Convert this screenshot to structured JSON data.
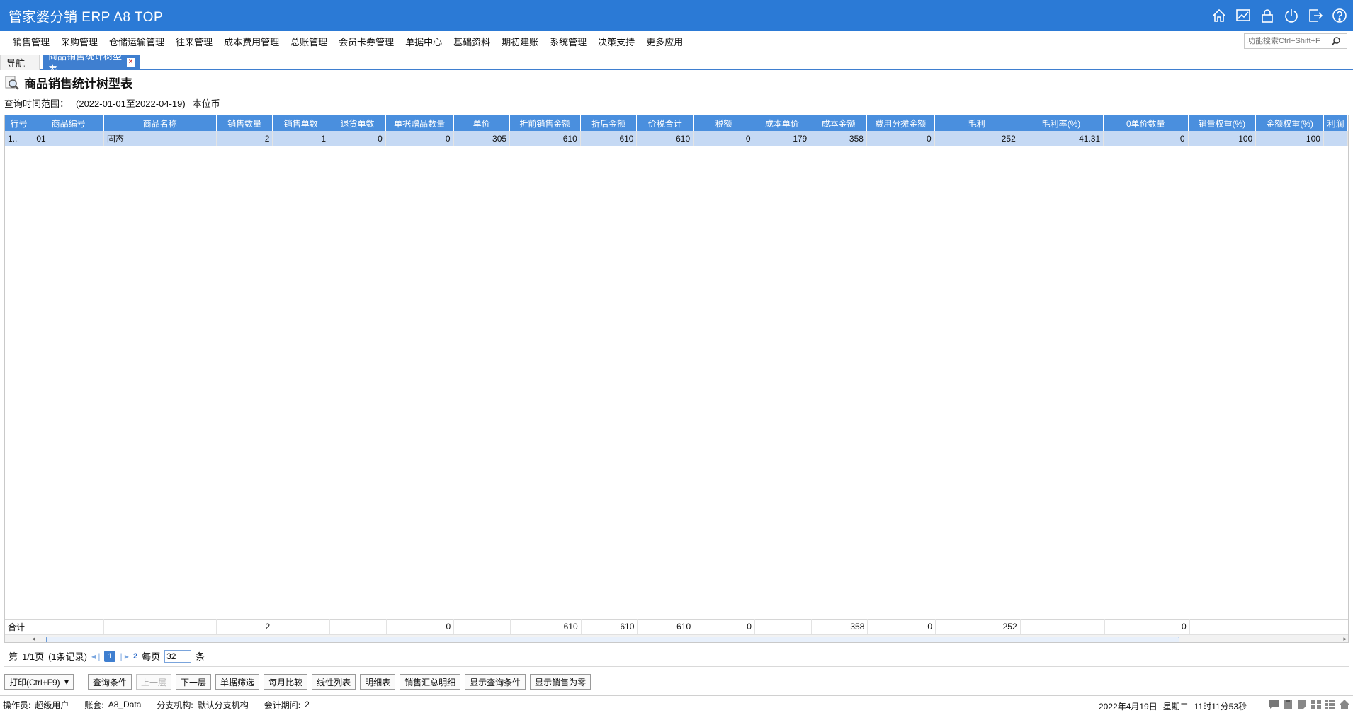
{
  "app": {
    "title": "管家婆分销 ERP A8 TOP"
  },
  "title_icons": [
    "home-icon",
    "chart-icon",
    "lock-icon",
    "power-icon",
    "exit-icon",
    "help-icon"
  ],
  "menu": {
    "items": [
      "销售管理",
      "采购管理",
      "仓储运输管理",
      "往来管理",
      "成本费用管理",
      "总账管理",
      "会员卡券管理",
      "单据中心",
      "基础资料",
      "期初建账",
      "系统管理",
      "决策支持",
      "更多应用"
    ]
  },
  "search": {
    "placeholder": "功能搜索Ctrl+Shift+F"
  },
  "tabs": {
    "nav": "导航",
    "active": "商品销售统计树型表"
  },
  "report": {
    "title": "商品销售统计树型表",
    "range_label": "查询时间范围：",
    "range_value": "(2022-01-01至2022-04-19)",
    "currency": "本位币"
  },
  "grid": {
    "columns": [
      "行号",
      "商品编号",
      "商品名称",
      "销售数量",
      "销售单数",
      "退货单数",
      "单据赠品数量",
      "单价",
      "折前销售金额",
      "折后金额",
      "价税合计",
      "税额",
      "成本单价",
      "成本金额",
      "费用分摊金额",
      "毛利",
      "毛利率(%)",
      "0单价数量",
      "销量权重(%)",
      "金额权重(%)",
      "利润"
    ],
    "rows": [
      [
        "1..",
        "01",
        "固态",
        "2",
        "1",
        "0",
        "0",
        "305",
        "610",
        "610",
        "610",
        "0",
        "179",
        "358",
        "0",
        "252",
        "41.31",
        "0",
        "100",
        "100",
        ""
      ]
    ],
    "summary": [
      "合计",
      "",
      "",
      "2",
      "",
      "",
      "0",
      "",
      "610",
      "610",
      "610",
      "0",
      "",
      "358",
      "0",
      "252",
      "",
      "0",
      "",
      "",
      ""
    ]
  },
  "pager": {
    "prefix": "第",
    "page_info": "1/1页",
    "records": "(1条记录)",
    "current_page": "1",
    "next_page": "2",
    "per_page_label": "每页",
    "per_page": "32",
    "unit": "条"
  },
  "toolbar": {
    "print": "打印(Ctrl+F9)",
    "buttons": [
      "查询条件",
      "上一层",
      "下一层",
      "单据筛选",
      "每月比较",
      "线性列表",
      "明细表",
      "销售汇总明细",
      "显示查询条件",
      "显示销售为零"
    ]
  },
  "status": {
    "operator_label": "操作员:",
    "operator": "超级用户",
    "account_label": "账套:",
    "account": "A8_Data",
    "branch_label": "分支机构:",
    "branch": "默认分支机构",
    "period_label": "会计期间:",
    "period": "2",
    "date": "2022年4月19日",
    "weekday": "星期二",
    "time": "11时11分53秒"
  }
}
